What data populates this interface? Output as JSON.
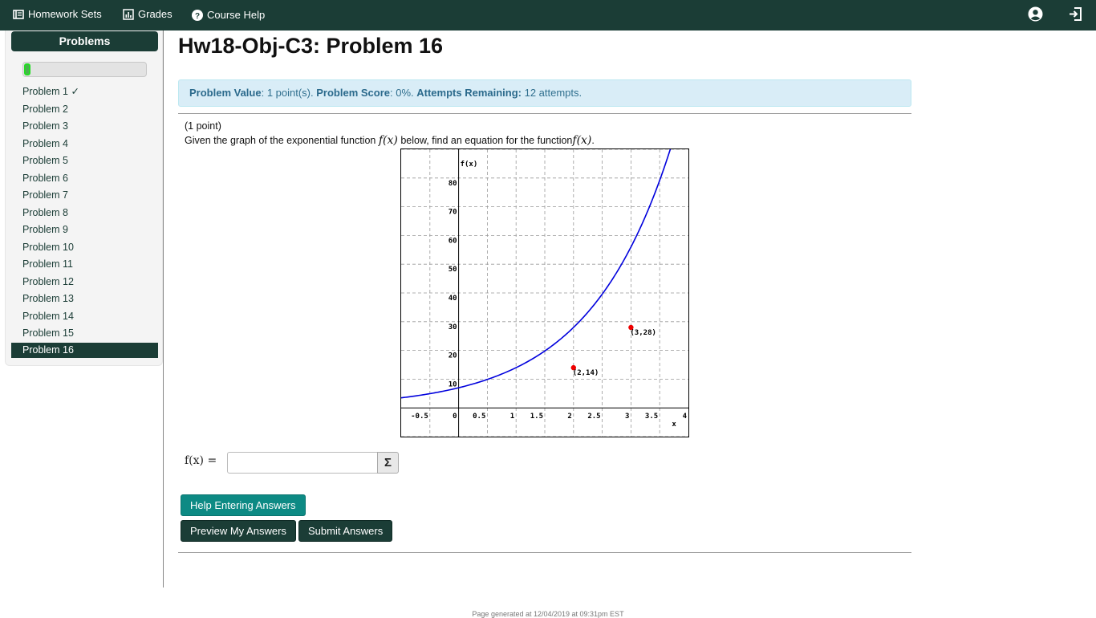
{
  "nav": {
    "homework_sets": "Homework Sets",
    "grades": "Grades",
    "course_help": "Course Help"
  },
  "sidebar": {
    "heading": "Problems",
    "progress": 0.04,
    "items": [
      {
        "label": "Problem 1 ✓",
        "active": false
      },
      {
        "label": "Problem 2",
        "active": false
      },
      {
        "label": "Problem 3",
        "active": false
      },
      {
        "label": "Problem 4",
        "active": false
      },
      {
        "label": "Problem 5",
        "active": false
      },
      {
        "label": "Problem 6",
        "active": false
      },
      {
        "label": "Problem 7",
        "active": false
      },
      {
        "label": "Problem 8",
        "active": false
      },
      {
        "label": "Problem 9",
        "active": false
      },
      {
        "label": "Problem 10",
        "active": false
      },
      {
        "label": "Problem 11",
        "active": false
      },
      {
        "label": "Problem 12",
        "active": false
      },
      {
        "label": "Problem 13",
        "active": false
      },
      {
        "label": "Problem 14",
        "active": false
      },
      {
        "label": "Problem 15",
        "active": false
      },
      {
        "label": "Problem 16",
        "active": true
      }
    ]
  },
  "page": {
    "title": "Hw18-Obj-C3: Problem 16"
  },
  "info": {
    "value_label": "Problem Value",
    "value_text": ": 1 point(s). ",
    "score_label": "Problem Score",
    "score_text": ": 0%. ",
    "attempts_label": "Attempts Remaining:",
    "attempts_text": " 12 attempts."
  },
  "problem": {
    "points": "(1 point)",
    "text_before": "Given the graph of the exponential function ",
    "function_name": "f(x)",
    "text_middle": " below, find an equation for the function",
    "text_end": "."
  },
  "chart_data": {
    "type": "line",
    "title": "",
    "xlabel": "x",
    "ylabel": "f(x)",
    "xlim": [
      -1,
      4
    ],
    "ylim": [
      -10,
      90
    ],
    "x_ticks": [
      "-0.5",
      "0",
      "0.5",
      "1",
      "1.5",
      "2",
      "2.5",
      "3",
      "3.5",
      "4"
    ],
    "y_ticks": [
      "10",
      "20",
      "30",
      "40",
      "50",
      "60",
      "70",
      "80"
    ],
    "grid": true,
    "curve": {
      "a": 7,
      "b": 2,
      "x_from": -1,
      "x_to": 4
    },
    "points": [
      {
        "x": 2,
        "y": 14,
        "label": "(2,14)"
      },
      {
        "x": 3,
        "y": 28,
        "label": "(3,28)"
      }
    ],
    "colors": {
      "curve": "#0000dd",
      "points": "#ee0000",
      "grid": "#999999"
    }
  },
  "answer": {
    "label": "f(x) =",
    "value": "",
    "sigma": "Σ"
  },
  "buttons": {
    "help": "Help Entering Answers",
    "preview": "Preview My Answers",
    "submit": "Submit Answers"
  },
  "footer": {
    "text": "Page generated at 12/04/2019 at 09:31pm EST"
  },
  "colors": {
    "brand": "#1b3d36",
    "help_button": "#0d8a84",
    "info_bg": "#d9edf7"
  }
}
